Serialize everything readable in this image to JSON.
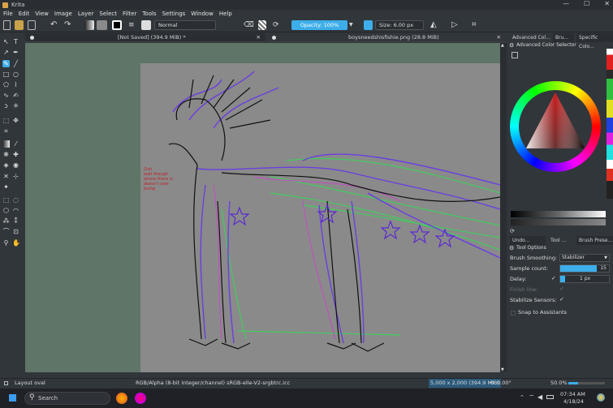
{
  "app": {
    "title": "Krita"
  },
  "menu": [
    "File",
    "Edit",
    "View",
    "Image",
    "Layer",
    "Select",
    "Filter",
    "Tools",
    "Settings",
    "Window",
    "Help"
  ],
  "toolbar": {
    "blend_mode": "Normal",
    "opacity_label": "Opacity: 100%",
    "size_label": "Size: 6.00 px",
    "accent": "#3daee9"
  },
  "tabs": [
    {
      "label": "[Not Saved]  (394.9 MiB) *"
    },
    {
      "label": "boysneedshisfishie.png (28.8 MiB)"
    }
  ],
  "canvas_text": {
    "annotation": "Guh\nwait though\nwhere there is\ndoesn't care\nbump"
  },
  "right_panel": {
    "top_tabs": [
      "Advanced Col...",
      "Bru...",
      "Specific Colo..."
    ],
    "color_selector_title": "Advanced Color Selector",
    "bottom_tabs": [
      "Undo...",
      "Tool ...",
      "Brush Prese..."
    ],
    "tool_options_title": "Tool Options",
    "brush_smoothing_label": "Brush Smoothing:",
    "brush_smoothing_value": "Stabilizer",
    "sample_count_label": "Sample count:",
    "sample_count_value": "15",
    "delay_label": "Delay:",
    "delay_value": "1 px",
    "finish_line_label": "Finish line:",
    "stabilize_sensors_label": "Stabilize Sensors:",
    "snap_label": "Snap to Assistants"
  },
  "status": {
    "tool": "Layout oval",
    "color_info": "RGB/Alpha (8-bit integer/channel)  sRGB-elle-V2-srgbtrc.icc",
    "dims": "5,000 x 2,000 (394.9 MiB)",
    "angle": "0.00°",
    "zoom": "50.0%"
  },
  "taskbar": {
    "search_placeholder": "Search",
    "time": "07:34 AM",
    "date": "4/18/24"
  }
}
